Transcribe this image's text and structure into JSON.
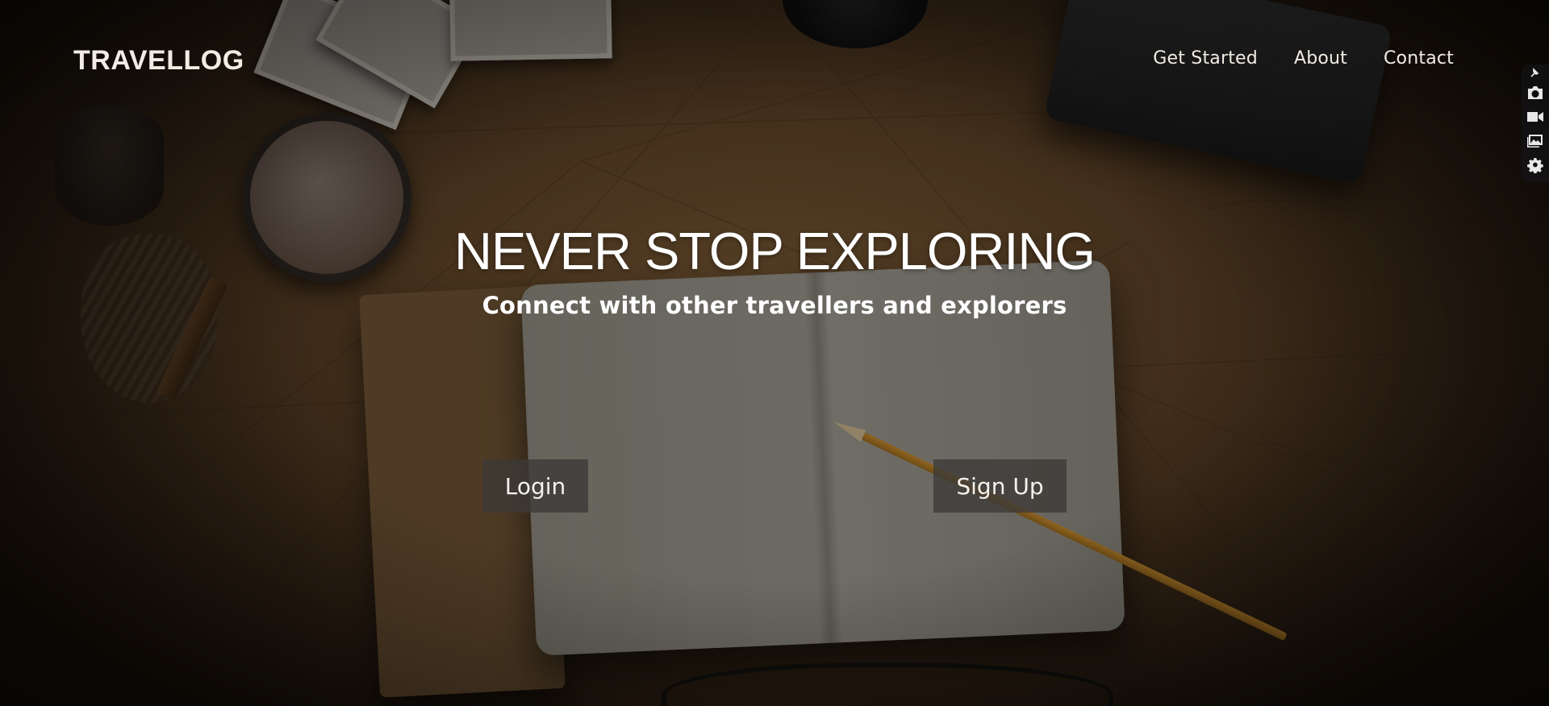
{
  "brand": {
    "name": "TRAVELLOG"
  },
  "nav": {
    "items": [
      {
        "label": "Get Started"
      },
      {
        "label": "About"
      },
      {
        "label": "Contact"
      }
    ]
  },
  "hero": {
    "title": "NEVER STOP EXPLORING",
    "subtitle": "Connect with other travellers and explorers",
    "buttons": {
      "login": "Login",
      "signup": "Sign Up"
    }
  },
  "toolbar": {
    "icons": [
      "pin-icon",
      "camera-icon",
      "video-icon",
      "image-icon",
      "settings-icon"
    ]
  },
  "colors": {
    "text_primary": "#ffffff",
    "button_bg": "#3c3a37",
    "background_tone": "#5b4126"
  }
}
